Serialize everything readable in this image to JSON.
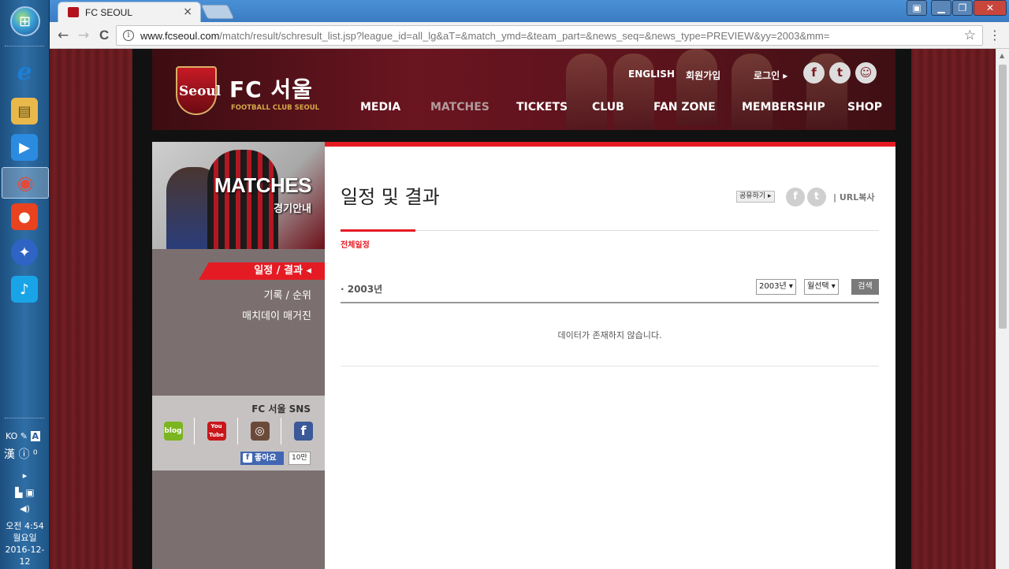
{
  "taskbar": {
    "start_icon": "windows-logo-icon",
    "apps": [
      {
        "name": "internet-explorer-icon",
        "glyph": "e",
        "color": "#1b7fd8"
      },
      {
        "name": "file-explorer-icon",
        "glyph": "▤",
        "color": "#e8b84a"
      },
      {
        "name": "media-player-icon",
        "glyph": "▶",
        "color": "#2b8be0"
      },
      {
        "name": "chrome-icon",
        "glyph": "◉",
        "color": "#e24a3b"
      },
      {
        "name": "gom-player-icon",
        "glyph": "●",
        "color": "#e8421f"
      },
      {
        "name": "compass-app-icon",
        "glyph": "✦",
        "color": "#2f63c4"
      },
      {
        "name": "music-app-icon",
        "glyph": "♪",
        "color": "#1aa4e8"
      }
    ],
    "tray": {
      "lang": "KO",
      "hanja": "漢",
      "time": "오전 4:54",
      "day": "월요일",
      "date": "2016-12-12"
    }
  },
  "browser": {
    "tab_title": "FC SEOUL",
    "tab_close": "×",
    "url_host": "www.fcseoul.com",
    "url_path": "/match/result/schresult_list.jsp?league_id=all_lg&aT=&match_ymd=&team_part=&news_seq=&news_type=PREVIEW&yy=2003&mm=",
    "back": "←",
    "forward": "→",
    "reload": "C",
    "star": "☆",
    "menu": "⋮"
  },
  "site": {
    "logo_emblem_text": "Seoul",
    "logo_ko": "FC 서울",
    "logo_en": "FOOTBALL CLUB SEOUL",
    "util": {
      "english": "ENGLISH",
      "signup": "회원가입",
      "login": "로그인 ▸"
    },
    "gnb": [
      "MEDIA",
      "MATCHES",
      "TICKETS",
      "CLUB",
      "FAN ZONE",
      "MEMBERSHIP",
      "SHOP"
    ],
    "lnb": {
      "title": "MATCHES",
      "subtitle": "경기안내",
      "menu": [
        "일정 / 결과 ◂",
        "기록 / 순위",
        "매치데이 매거진"
      ],
      "sns_title": "FC 서울 SNS",
      "sns_buttons": [
        {
          "name": "blog",
          "label": "blog",
          "color": "#7bb51f"
        },
        {
          "name": "youtube",
          "label": "You Tube",
          "color": "#c9161b"
        },
        {
          "name": "instagram",
          "label": "◎",
          "color": "#6b4a3a"
        },
        {
          "name": "facebook",
          "label": "f",
          "color": "#3b5998"
        }
      ],
      "like_label": "좋아요",
      "like_count": "10만"
    },
    "main": {
      "page_title": "일정 및 결과",
      "share_label": "공유하기 ▸",
      "url_copy": "|  URL복사",
      "subtab": "전체일정",
      "year_label": "·  2003년",
      "year_select": "2003년 ▾",
      "month_select": "월선택 ▾",
      "search_btn": "검색",
      "empty_message": "데이터가 존재하지 않습니다."
    }
  }
}
